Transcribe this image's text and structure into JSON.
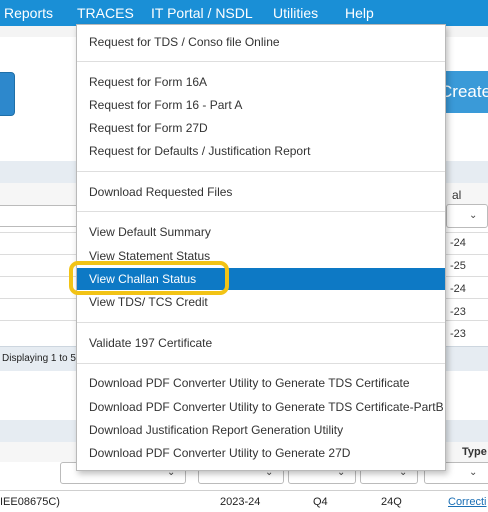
{
  "menubar": {
    "items": [
      "Reports",
      "TRACES",
      "IT Portal / NSDL",
      "Utilities",
      "Help"
    ]
  },
  "background": {
    "create_button": "Create",
    "year_header": "al year",
    "year_cells": [
      "-24",
      "-25",
      "-24",
      "-23",
      "-23"
    ],
    "pagination_text": "Displaying 1 to 5",
    "type_header": "Type",
    "footer_row": {
      "id": "IEE08675C)",
      "year": "2023-24",
      "quarter": "Q4",
      "form": "24Q",
      "link": "Correcti"
    }
  },
  "dropdown": {
    "groups": [
      [
        "Request for TDS / Conso file Online"
      ],
      [
        "Request for Form 16A",
        "Request for Form 16 - Part A",
        "Request for Form 27D",
        "Request for Defaults / Justification Report"
      ],
      [
        "Download Requested Files"
      ],
      [
        "View Default Summary",
        "View Statement Status",
        "View Challan Status",
        "View TDS/ TCS Credit"
      ],
      [
        "Validate 197 Certificate"
      ],
      [
        "Download PDF Converter Utility to Generate TDS Certificate",
        "Download PDF Converter Utility to Generate TDS Certificate-PartB",
        "Download Justification Report Generation Utility",
        "Download PDF Converter Utility to Generate 27D"
      ]
    ],
    "active_item": "View Challan Status",
    "highlight_color": "#f2c315",
    "active_color": "#0d79c5",
    "menubar_color": "#1a8fd6"
  }
}
